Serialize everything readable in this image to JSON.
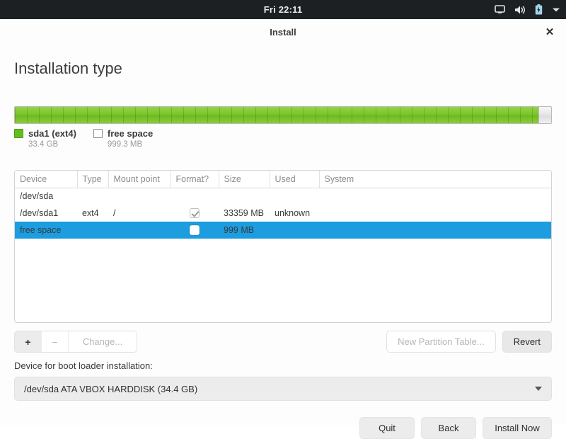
{
  "topbar": {
    "clock": "Fri 22:11",
    "icons": [
      {
        "name": "display-icon"
      },
      {
        "name": "volume-icon"
      },
      {
        "name": "battery-charging-icon"
      },
      {
        "name": "system-menu-chevron-icon"
      }
    ]
  },
  "window": {
    "title": "Install",
    "close_label": "✕"
  },
  "page": {
    "heading": "Installation type"
  },
  "partition_bar": {
    "segments": [
      {
        "label": "sda1 (ext4)",
        "size": "33.4 GB",
        "percent": 97.6,
        "kind": "used",
        "color": "#7cc52b"
      },
      {
        "label": "free space",
        "size": "999.3 MB",
        "percent": 2.4,
        "kind": "free",
        "color": "#e6e6e6"
      }
    ]
  },
  "legend": [
    {
      "label": "sda1 (ext4)",
      "size": "33.4 GB",
      "swatch": "green"
    },
    {
      "label": "free space",
      "size": "999.3 MB",
      "swatch": "white"
    }
  ],
  "table": {
    "columns": [
      "Device",
      "Type",
      "Mount point",
      "Format?",
      "Size",
      "Used",
      "System"
    ],
    "rows": [
      {
        "kind": "disk",
        "device": "/dev/sda",
        "type": "",
        "mount_point": "",
        "format": "none",
        "size": "",
        "used": "",
        "system": "",
        "selected": false
      },
      {
        "kind": "partition",
        "device": "/dev/sda1",
        "type": "ext4",
        "mount_point": "/",
        "format": "checked",
        "size": "33359 MB",
        "used": "unknown",
        "system": "",
        "selected": false
      },
      {
        "kind": "freespace",
        "device": "free space",
        "type": "",
        "mount_point": "",
        "format": "unchecked",
        "size": "999 MB",
        "used": "",
        "system": "",
        "selected": true
      }
    ]
  },
  "partition_toolbar": {
    "add_label": "+",
    "remove_label": "−",
    "change_label": "Change...",
    "new_table_label": "New Partition Table...",
    "revert_label": "Revert"
  },
  "boot_loader": {
    "label": "Device for boot loader installation:",
    "selected": "/dev/sda  ATA VBOX HARDDISK (34.4 GB)"
  },
  "footer": {
    "quit_label": "Quit",
    "back_label": "Back",
    "install_label": "Install Now"
  },
  "colors": {
    "selection_blue": "#1b9de0",
    "partition_green": "#7cc52b",
    "topbar_dark": "#1c2023"
  }
}
